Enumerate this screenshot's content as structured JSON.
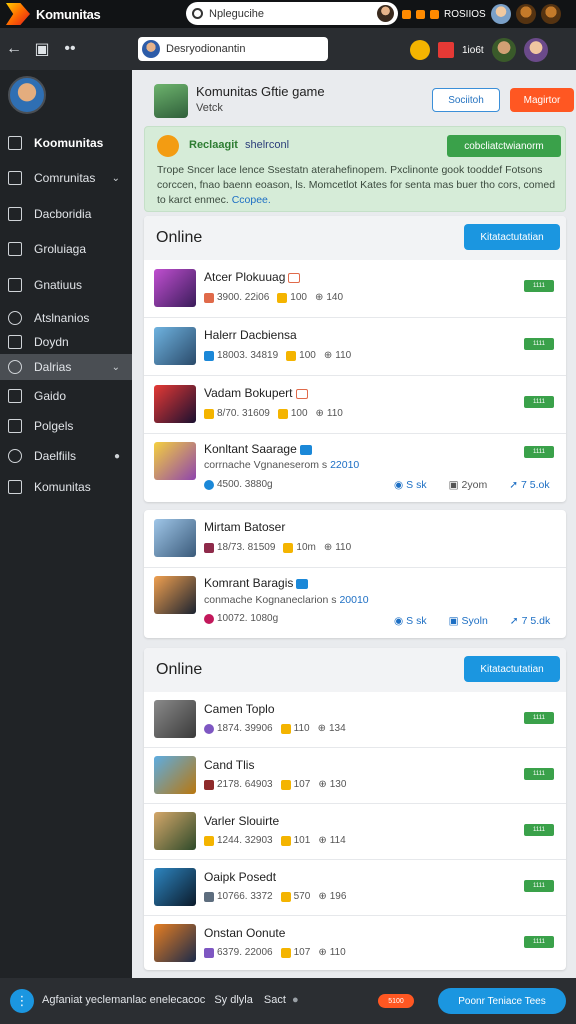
{
  "topbar": {
    "brand": "Komunitas",
    "search_text": "Nplegucihe",
    "status_text": "ROSIIOS"
  },
  "navbar": {
    "input_text": "Desryodionantin",
    "count_text": "1io6t"
  },
  "sidebar": {
    "items": [
      {
        "label": "Koomunitas",
        "icon": "pencil-icon"
      },
      {
        "label": "Comrunitas",
        "icon": "chat-icon"
      },
      {
        "label": "Dacboridia",
        "icon": "dashboard-icon"
      },
      {
        "label": "Groluiaga",
        "icon": "edit-icon"
      },
      {
        "label": "Gnatiuus",
        "icon": "chart-icon"
      },
      {
        "label": "Atslnanios",
        "icon": "globe-icon"
      },
      {
        "label": "Doydn",
        "icon": "pen-icon"
      },
      {
        "label": "Dalrias",
        "icon": "info-icon"
      },
      {
        "label": "Gaido",
        "icon": "home-icon"
      },
      {
        "label": "Polgels",
        "icon": "list-icon"
      },
      {
        "label": "Daelfiils",
        "icon": "clock-icon"
      },
      {
        "label": "Komunitas",
        "icon": "briefcase-icon"
      }
    ]
  },
  "header": {
    "title": "Komunitas Gftie game",
    "subtitle": "Vetck",
    "btn_outline": "Sociitoh",
    "btn_orange": "Magirtor"
  },
  "info": {
    "title": "Reclaagit",
    "tag": "shelrconl",
    "button": "cobcliatctwianorm",
    "body": "Trope Sncer lace lence Ssestatn aterahefinopem. Pxclinonte gook tooddef Fotsons corccen, fnao baenn eoason, ls. Momcetlot Kates for senta mas buer tho cors, comed to karct enmec.",
    "link": "Ccopee."
  },
  "section1": {
    "title": "Online",
    "button": "Kitatactutatian",
    "rows": [
      {
        "title": "Atcer Plokuuag",
        "sub": "",
        "meta": [
          "3900. 22i06",
          "100",
          "140"
        ],
        "pill": "1111"
      },
      {
        "title": "Halerr Dacbiensa",
        "sub": "",
        "meta": [
          "18003. 34819",
          "100",
          "110"
        ],
        "pill": "1111"
      },
      {
        "title": "Vadam Bokupert",
        "sub": "",
        "meta": [
          "8/70. 31609",
          "100",
          "110"
        ],
        "pill": "1111"
      },
      {
        "title": "Konltant Saarage",
        "sub": "corrnache Vgnaneserom s",
        "sub_hl": "22010",
        "meta": [
          "4500. 3880g"
        ],
        "actions": [
          "S sk",
          "2yom",
          "7 5.ok"
        ],
        "pill": "1111"
      }
    ]
  },
  "section1b": {
    "rows": [
      {
        "title": "Mirtam Batoser",
        "sub": "",
        "meta": [
          "18/73. 81509",
          "10m",
          "110"
        ]
      },
      {
        "title": "Komrant Baragis",
        "sub": "conmache Kognaneclarion s",
        "sub_hl": "20010",
        "meta": [
          "10072. 1080g"
        ],
        "actions": [
          "S sk",
          "Syoln",
          "7 5.dk"
        ]
      }
    ]
  },
  "section2": {
    "title": "Online",
    "button": "Kitatactutatian",
    "rows": [
      {
        "title": "Camen Toplo",
        "meta": [
          "1874. 39906",
          "110",
          "134"
        ],
        "pill": "1111"
      },
      {
        "title": "Cand Tlis",
        "meta": [
          "2178. 64903",
          "107",
          "130"
        ],
        "pill": "1111"
      },
      {
        "title": "Varler Slouirte",
        "meta": [
          "1244. 32903",
          "101",
          "114"
        ],
        "pill": "1111"
      },
      {
        "title": "Oaipk Posedt",
        "meta": [
          "10766. 3372",
          "570",
          "196"
        ],
        "pill": "1111"
      },
      {
        "title": "Onstan Oonute",
        "meta": [
          "6379. 22006",
          "107",
          "110"
        ],
        "pill": "1111"
      }
    ]
  },
  "bottombar": {
    "text": "Agfaniat yeclemanlac enelecacoc",
    "text2": "Sy dlyla",
    "text3": "Sact",
    "pill": "5100",
    "button": "Poonr Teniace Tees"
  }
}
